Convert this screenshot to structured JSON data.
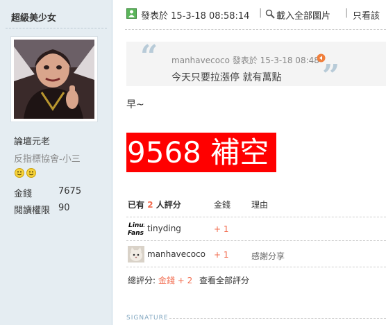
{
  "author": {
    "name": "超級美少女",
    "rank": "論壇元老",
    "custom_title": "反指標協會-小三",
    "stats": [
      {
        "label": "金錢",
        "value": "7675"
      },
      {
        "label": "閱讀權限",
        "value": "90"
      }
    ]
  },
  "meta": {
    "posted_label": "發表於",
    "posted_time": "15-3-18 08:58:14",
    "load_all_images": "載入全部圖片",
    "only_see": "只看該"
  },
  "quote": {
    "author": "manhavecoco",
    "posted_label": "發表於",
    "posted_time": "15-3-18 08:48",
    "body": "今天只要拉漲停 就有萬點"
  },
  "post": {
    "line1": "早~",
    "highlight": "9568 補空"
  },
  "rating": {
    "header_prefix": "已有",
    "header_count": "2",
    "header_suffix": "人評分",
    "col_money": "金錢",
    "col_reason": "理由",
    "rows": [
      {
        "user": "tinyding",
        "amount": "+ 1",
        "reason": "",
        "avatar_icon": "linux-fans-avatar"
      },
      {
        "user": "manhavecoco",
        "amount": "+ 1",
        "reason": "感謝分享",
        "avatar_icon": "cat-avatar"
      }
    ],
    "total_label": "總評分:",
    "total_item": "金錢",
    "total_value": "+ 2",
    "view_all": "查看全部評分"
  },
  "signature_label": "SIGNATURE",
  "colors": {
    "sidebar_bg": "#e5edf2",
    "highlight_bg": "#ff0000",
    "rating_accent": "#f26c4f",
    "quote_mark": "#b8cbd8"
  }
}
